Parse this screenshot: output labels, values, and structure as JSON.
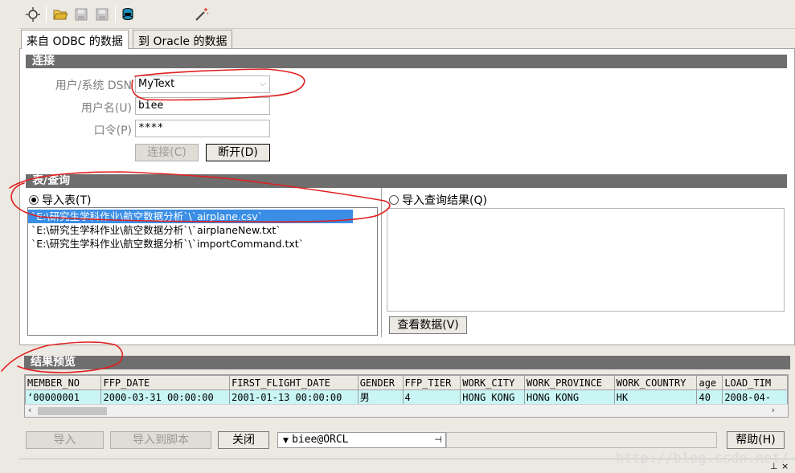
{
  "toolbar": {
    "icons": [
      "new-connection-icon",
      "open-folder-icon",
      "save-icon",
      "save-as-icon",
      "database-icon",
      "wand-icon"
    ]
  },
  "tabs": [
    {
      "label": "来自 ODBC 的数据",
      "active": true
    },
    {
      "label": "到 Oracle 的数据",
      "active": false
    }
  ],
  "connection": {
    "header": "连接",
    "dsn_label": "用户/系统 DSN",
    "dsn_value": "MyText",
    "user_label": "用户名(U)",
    "user_value": "biee",
    "password_label": "口令(P)",
    "password_value": "****",
    "connect_button": "连接(C)",
    "disconnect_button": "断开(D)"
  },
  "table_query": {
    "header": "表/查询",
    "import_table_label": "导入表(T)",
    "import_query_label": "导入查询结果(Q)",
    "files": [
      "`E:\\研究生学科作业\\航空数据分析`\\`airplane.csv`",
      "`E:\\研究生学科作业\\航空数据分析`\\`airplaneNew.txt`",
      "`E:\\研究生学科作业\\航空数据分析`\\`importCommand.txt`"
    ],
    "view_data_button": "查看数据(V)"
  },
  "preview": {
    "header": "结果预览",
    "columns": [
      "MEMBER_NO",
      "FFP_DATE",
      "FIRST_FLIGHT_DATE",
      "GENDER",
      "FFP_TIER",
      "WORK_CITY",
      "WORK_PROVINCE",
      "WORK_COUNTRY",
      "age",
      "LOAD_TIM"
    ],
    "rows": [
      [
        "‘00000001",
        "2000-03-31 00:00:00",
        "2001-01-13 00:00:00",
        "男",
        "4",
        "HONG KONG",
        "HONG KONG",
        "HK",
        "40",
        "2008-04-"
      ]
    ]
  },
  "bottom": {
    "import_button": "导入",
    "import_script_button": "导入到脚本",
    "close_button": "关闭",
    "connection_select": "biee@ORCL",
    "help_button": "帮助(H)"
  },
  "watermark": "http://blog.csdn.net/",
  "colors": {
    "section_header": "#6e6e6e",
    "selection": "#3a8ee6",
    "grid_row": "#c9f5f5",
    "annotation": "#e02020"
  }
}
